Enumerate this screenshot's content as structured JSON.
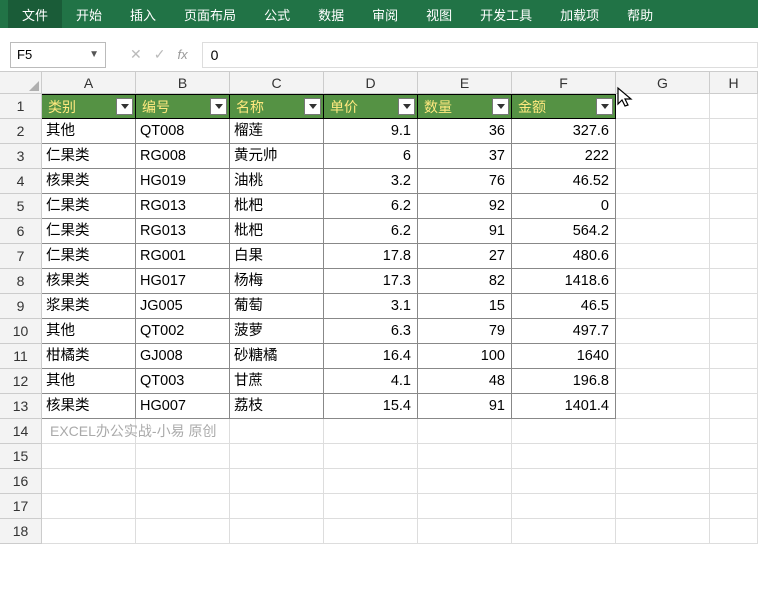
{
  "ribbon": {
    "tabs": [
      "文件",
      "开始",
      "插入",
      "页面布局",
      "公式",
      "数据",
      "审阅",
      "视图",
      "开发工具",
      "加载项",
      "帮助"
    ]
  },
  "nameBox": "F5",
  "formulaValue": "0",
  "columns": [
    "A",
    "B",
    "C",
    "D",
    "E",
    "F",
    "G",
    "H"
  ],
  "headers": [
    "类别",
    "编号",
    "名称",
    "单价",
    "数量",
    "金额"
  ],
  "rows": [
    {
      "n": "1"
    },
    {
      "n": "2",
      "c": [
        "其他",
        "QT008",
        "榴莲",
        "9.1",
        "36",
        "327.6"
      ]
    },
    {
      "n": "3",
      "c": [
        "仁果类",
        "RG008",
        "黄元帅",
        "6",
        "37",
        "222"
      ]
    },
    {
      "n": "4",
      "c": [
        "核果类",
        "HG019",
        "油桃",
        "3.2",
        "76",
        "46.52"
      ]
    },
    {
      "n": "5",
      "c": [
        "仁果类",
        "RG013",
        "枇杷",
        "6.2",
        "92",
        "0"
      ]
    },
    {
      "n": "6",
      "c": [
        "仁果类",
        "RG013",
        "枇杷",
        "6.2",
        "91",
        "564.2"
      ]
    },
    {
      "n": "7",
      "c": [
        "仁果类",
        "RG001",
        "白果",
        "17.8",
        "27",
        "480.6"
      ]
    },
    {
      "n": "8",
      "c": [
        "核果类",
        "HG017",
        "杨梅",
        "17.3",
        "82",
        "1418.6"
      ]
    },
    {
      "n": "9",
      "c": [
        "浆果类",
        "JG005",
        "葡萄",
        "3.1",
        "15",
        "46.5"
      ]
    },
    {
      "n": "10",
      "c": [
        "其他",
        "QT002",
        "菠萝",
        "6.3",
        "79",
        "497.7"
      ]
    },
    {
      "n": "11",
      "c": [
        "柑橘类",
        "GJ008",
        "砂糖橘",
        "16.4",
        "100",
        "1640"
      ]
    },
    {
      "n": "12",
      "c": [
        "其他",
        "QT003",
        "甘蔗",
        "4.1",
        "48",
        "196.8"
      ]
    },
    {
      "n": "13",
      "c": [
        "核果类",
        "HG007",
        "荔枝",
        "15.4",
        "91",
        "1401.4"
      ]
    },
    {
      "n": "14",
      "note": "EXCEL办公实战-小易 原创"
    },
    {
      "n": "15"
    },
    {
      "n": "16"
    },
    {
      "n": "17"
    },
    {
      "n": "18"
    }
  ],
  "chart_data": {
    "type": "table",
    "columns": [
      "类别",
      "编号",
      "名称",
      "单价",
      "数量",
      "金额"
    ],
    "data": [
      [
        "其他",
        "QT008",
        "榴莲",
        9.1,
        36,
        327.6
      ],
      [
        "仁果类",
        "RG008",
        "黄元帅",
        6,
        37,
        222
      ],
      [
        "核果类",
        "HG019",
        "油桃",
        3.2,
        76,
        46.52
      ],
      [
        "仁果类",
        "RG013",
        "枇杷",
        6.2,
        92,
        0
      ],
      [
        "仁果类",
        "RG013",
        "枇杷",
        6.2,
        91,
        564.2
      ],
      [
        "仁果类",
        "RG001",
        "白果",
        17.8,
        27,
        480.6
      ],
      [
        "核果类",
        "HG017",
        "杨梅",
        17.3,
        82,
        1418.6
      ],
      [
        "浆果类",
        "JG005",
        "葡萄",
        3.1,
        15,
        46.5
      ],
      [
        "其他",
        "QT002",
        "菠萝",
        6.3,
        79,
        497.7
      ],
      [
        "柑橘类",
        "GJ008",
        "砂糖橘",
        16.4,
        100,
        1640
      ],
      [
        "其他",
        "QT003",
        "甘蔗",
        4.1,
        48,
        196.8
      ],
      [
        "核果类",
        "HG007",
        "荔枝",
        15.4,
        91,
        1401.4
      ]
    ]
  }
}
